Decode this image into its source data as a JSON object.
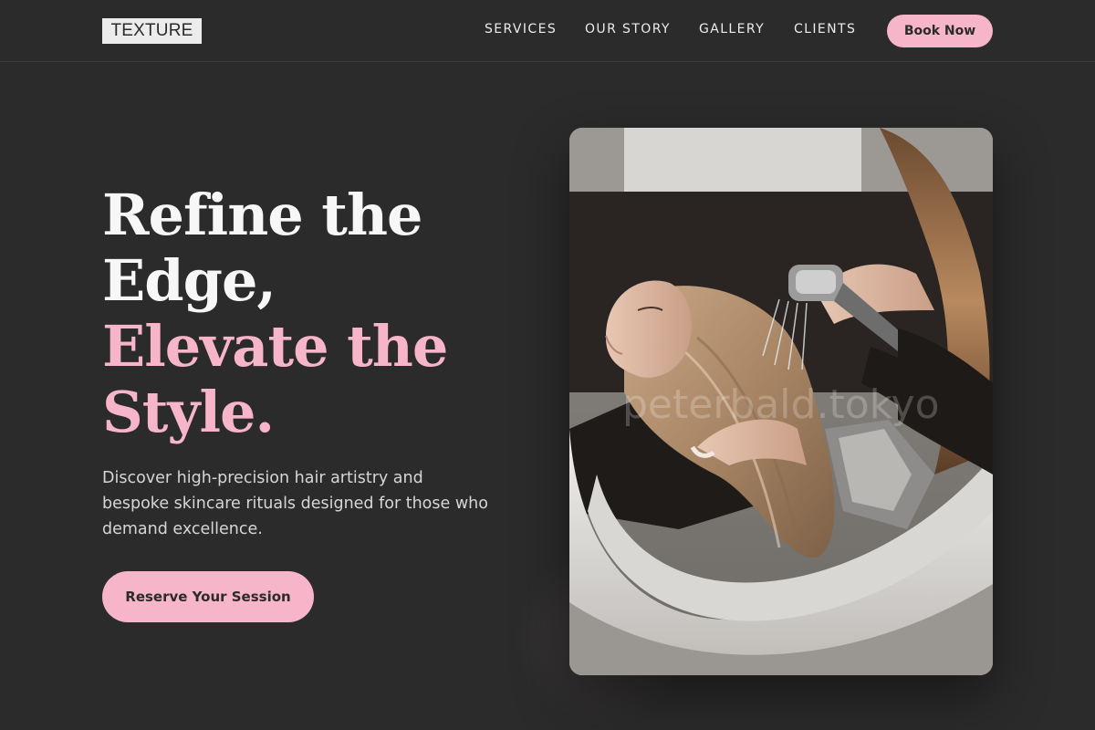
{
  "header": {
    "logo": "TEXTURE",
    "nav": [
      "SERVICES",
      "OUR STORY",
      "GALLERY",
      "CLIENTS"
    ],
    "book_button": "Book Now"
  },
  "hero": {
    "title_line1": "Refine the",
    "title_line2": "Edge,",
    "title_line3": "Elevate the",
    "title_line4": "Style.",
    "subtitle": "Discover high-precision hair artistry and bespoke skincare rituals designed for those who demand excellence.",
    "cta_button": "Reserve Your Session"
  },
  "photo": {
    "watermark": "peterbald.tokyo"
  },
  "colors": {
    "background": "#2b2b2b",
    "accent_pink": "#f7b5c9",
    "text_light": "#f7f7f7",
    "text_muted": "#d6d6d6"
  }
}
